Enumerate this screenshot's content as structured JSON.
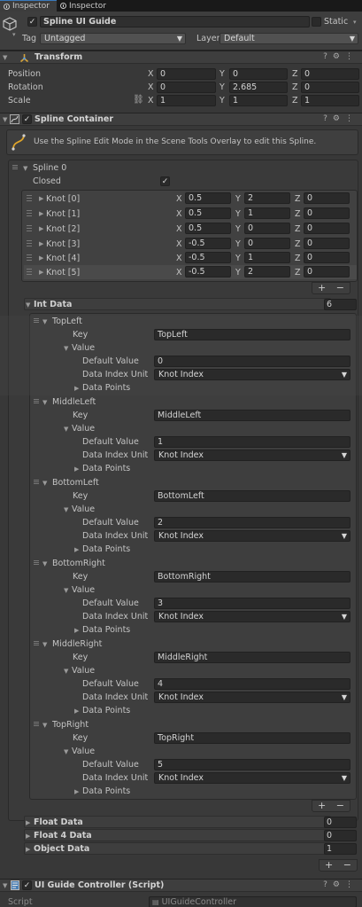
{
  "tabs": [
    "Inspector",
    "Inspector"
  ],
  "header": {
    "name": "Spline UI Guide",
    "static_label": "Static",
    "tag_label": "Tag",
    "tag_value": "Untagged",
    "layer_label": "Layer",
    "layer_value": "Default"
  },
  "transform": {
    "title": "Transform",
    "position": {
      "label": "Position",
      "x": "0",
      "y": "0",
      "z": "0"
    },
    "rotation": {
      "label": "Rotation",
      "x": "0",
      "y": "2.685",
      "z": "0"
    },
    "scale": {
      "label": "Scale",
      "x": "1",
      "y": "1",
      "z": "1"
    }
  },
  "spline_container": {
    "title": "Spline Container",
    "info": "Use the Spline Edit Mode in the Scene Tools Overlay to edit this Spline.",
    "spline_label": "Spline 0",
    "closed_label": "Closed",
    "knots": [
      {
        "label": "Knot [0]",
        "x": "0.5",
        "y": "2",
        "z": "0"
      },
      {
        "label": "Knot [1]",
        "x": "0.5",
        "y": "1",
        "z": "0"
      },
      {
        "label": "Knot [2]",
        "x": "0.5",
        "y": "0",
        "z": "0"
      },
      {
        "label": "Knot [3]",
        "x": "-0.5",
        "y": "0",
        "z": "0"
      },
      {
        "label": "Knot [4]",
        "x": "-0.5",
        "y": "1",
        "z": "0"
      },
      {
        "label": "Knot [5]",
        "x": "-0.5",
        "y": "2",
        "z": "0"
      }
    ],
    "int_data": {
      "label": "Int Data",
      "count": "6",
      "key_label": "Key",
      "value_label": "Value",
      "default_label": "Default Value",
      "unit_label": "Data Index Unit",
      "points_label": "Data Points",
      "entries": [
        {
          "name": "TopLeft",
          "key": "TopLeft",
          "default": "0",
          "unit": "Knot Index"
        },
        {
          "name": "MiddleLeft",
          "key": "MiddleLeft",
          "default": "1",
          "unit": "Knot Index"
        },
        {
          "name": "BottomLeft",
          "key": "BottomLeft",
          "default": "2",
          "unit": "Knot Index"
        },
        {
          "name": "BottomRight",
          "key": "BottomRight",
          "default": "3",
          "unit": "Knot Index"
        },
        {
          "name": "MiddleRight",
          "key": "MiddleRight",
          "default": "4",
          "unit": "Knot Index"
        },
        {
          "name": "TopRight",
          "key": "TopRight",
          "default": "5",
          "unit": "Knot Index"
        }
      ]
    },
    "float_data": {
      "label": "Float Data",
      "count": "0"
    },
    "float4_data": {
      "label": "Float 4 Data",
      "count": "0"
    },
    "object_data": {
      "label": "Object Data",
      "count": "1"
    }
  },
  "ui_guide": {
    "title": "UI Guide Controller (Script)",
    "script_label": "Script",
    "script_value": "UIGuideController"
  },
  "axis": {
    "x": "X",
    "y": "Y",
    "z": "Z"
  },
  "buttons": {
    "plus": "+",
    "minus": "−"
  }
}
